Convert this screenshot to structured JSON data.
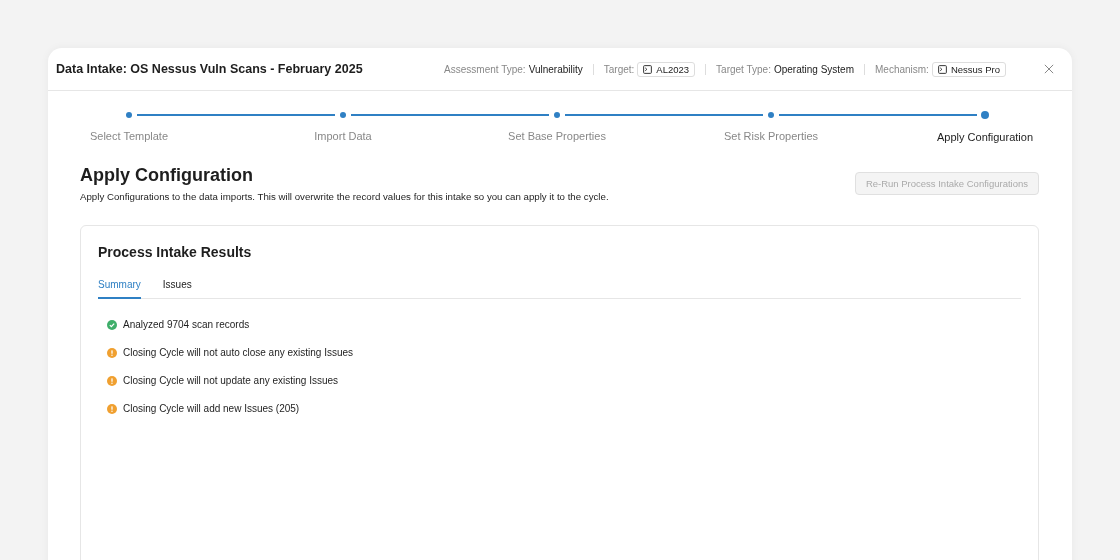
{
  "window": {
    "title": "Data Intake: OS Nessus Vuln Scans - February 2025"
  },
  "meta": [
    {
      "label": "Assessment Type:",
      "value": "Vulnerability",
      "kind": "text"
    },
    {
      "label": "Target:",
      "value": "AL2023",
      "kind": "chip"
    },
    {
      "label": "Target Type:",
      "value": "Operating System",
      "kind": "text"
    },
    {
      "label": "Mechanism:",
      "value": "Nessus Pro",
      "kind": "chip"
    }
  ],
  "steps": [
    {
      "label": "Select Template",
      "selected": false
    },
    {
      "label": "Import Data",
      "selected": false
    },
    {
      "label": "Set Base Properties",
      "selected": false
    },
    {
      "label": "Set Risk Properties",
      "selected": false
    },
    {
      "label": "Apply Configuration",
      "selected": true
    }
  ],
  "heading": "Apply Configuration",
  "description": "Apply Configurations to the data imports. This will overwrite the record values for this intake so you can apply it to the cycle.",
  "rerun_button": {
    "label": "Re-Run Process Intake Configurations",
    "disabled": true
  },
  "card": {
    "title": "Process Intake Results",
    "tabs": [
      {
        "label": "Summary",
        "selected": true
      },
      {
        "label": "Issues",
        "selected": false
      }
    ],
    "results": [
      {
        "text": "Analyzed 9704 scan records",
        "kind": "success"
      },
      {
        "text": "Closing Cycle will not auto close any existing Issues",
        "kind": "warning"
      },
      {
        "text": "Closing Cycle will not update any existing Issues",
        "kind": "warning"
      },
      {
        "text": "Closing Cycle will add new Issues (205)",
        "kind": "warning"
      }
    ]
  }
}
